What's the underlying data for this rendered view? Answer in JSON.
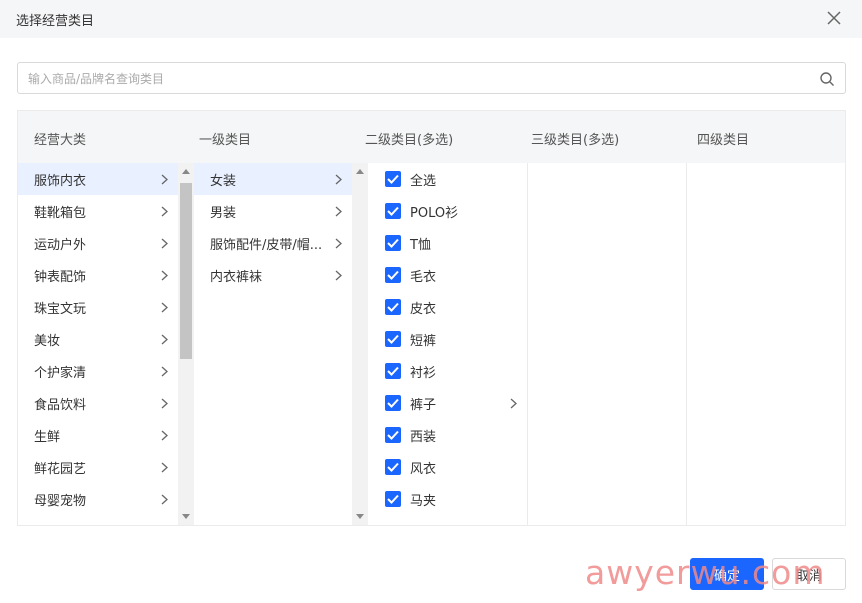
{
  "header": {
    "title": "选择经营类目"
  },
  "search": {
    "placeholder": "输入商品/品牌名查询类目"
  },
  "columns": {
    "c1": "经营大类",
    "c2": "一级类目",
    "c3": "二级类目(多选)",
    "c4": "三级类目(多选)",
    "c5": "四级类目"
  },
  "level1": [
    "服饰内衣",
    "鞋靴箱包",
    "运动户外",
    "钟表配饰",
    "珠宝文玩",
    "美妆",
    "个护家清",
    "食品饮料",
    "生鲜",
    "鲜花园艺",
    "母婴宠物"
  ],
  "level2": [
    "女装",
    "男装",
    "服饰配件/皮带/帽...",
    "内衣裤袜"
  ],
  "level3": [
    "全选",
    "POLO衫",
    "T恤",
    "毛衣",
    "皮衣",
    "短裤",
    "衬衫",
    "裤子",
    "西装",
    "风衣",
    "马夹"
  ],
  "buttons": {
    "ok": "确定",
    "cancel": "取消"
  },
  "watermark": "awyerwu.com",
  "colors": {
    "accent": "#1a66ff",
    "active_row": "#e9f0ff"
  }
}
